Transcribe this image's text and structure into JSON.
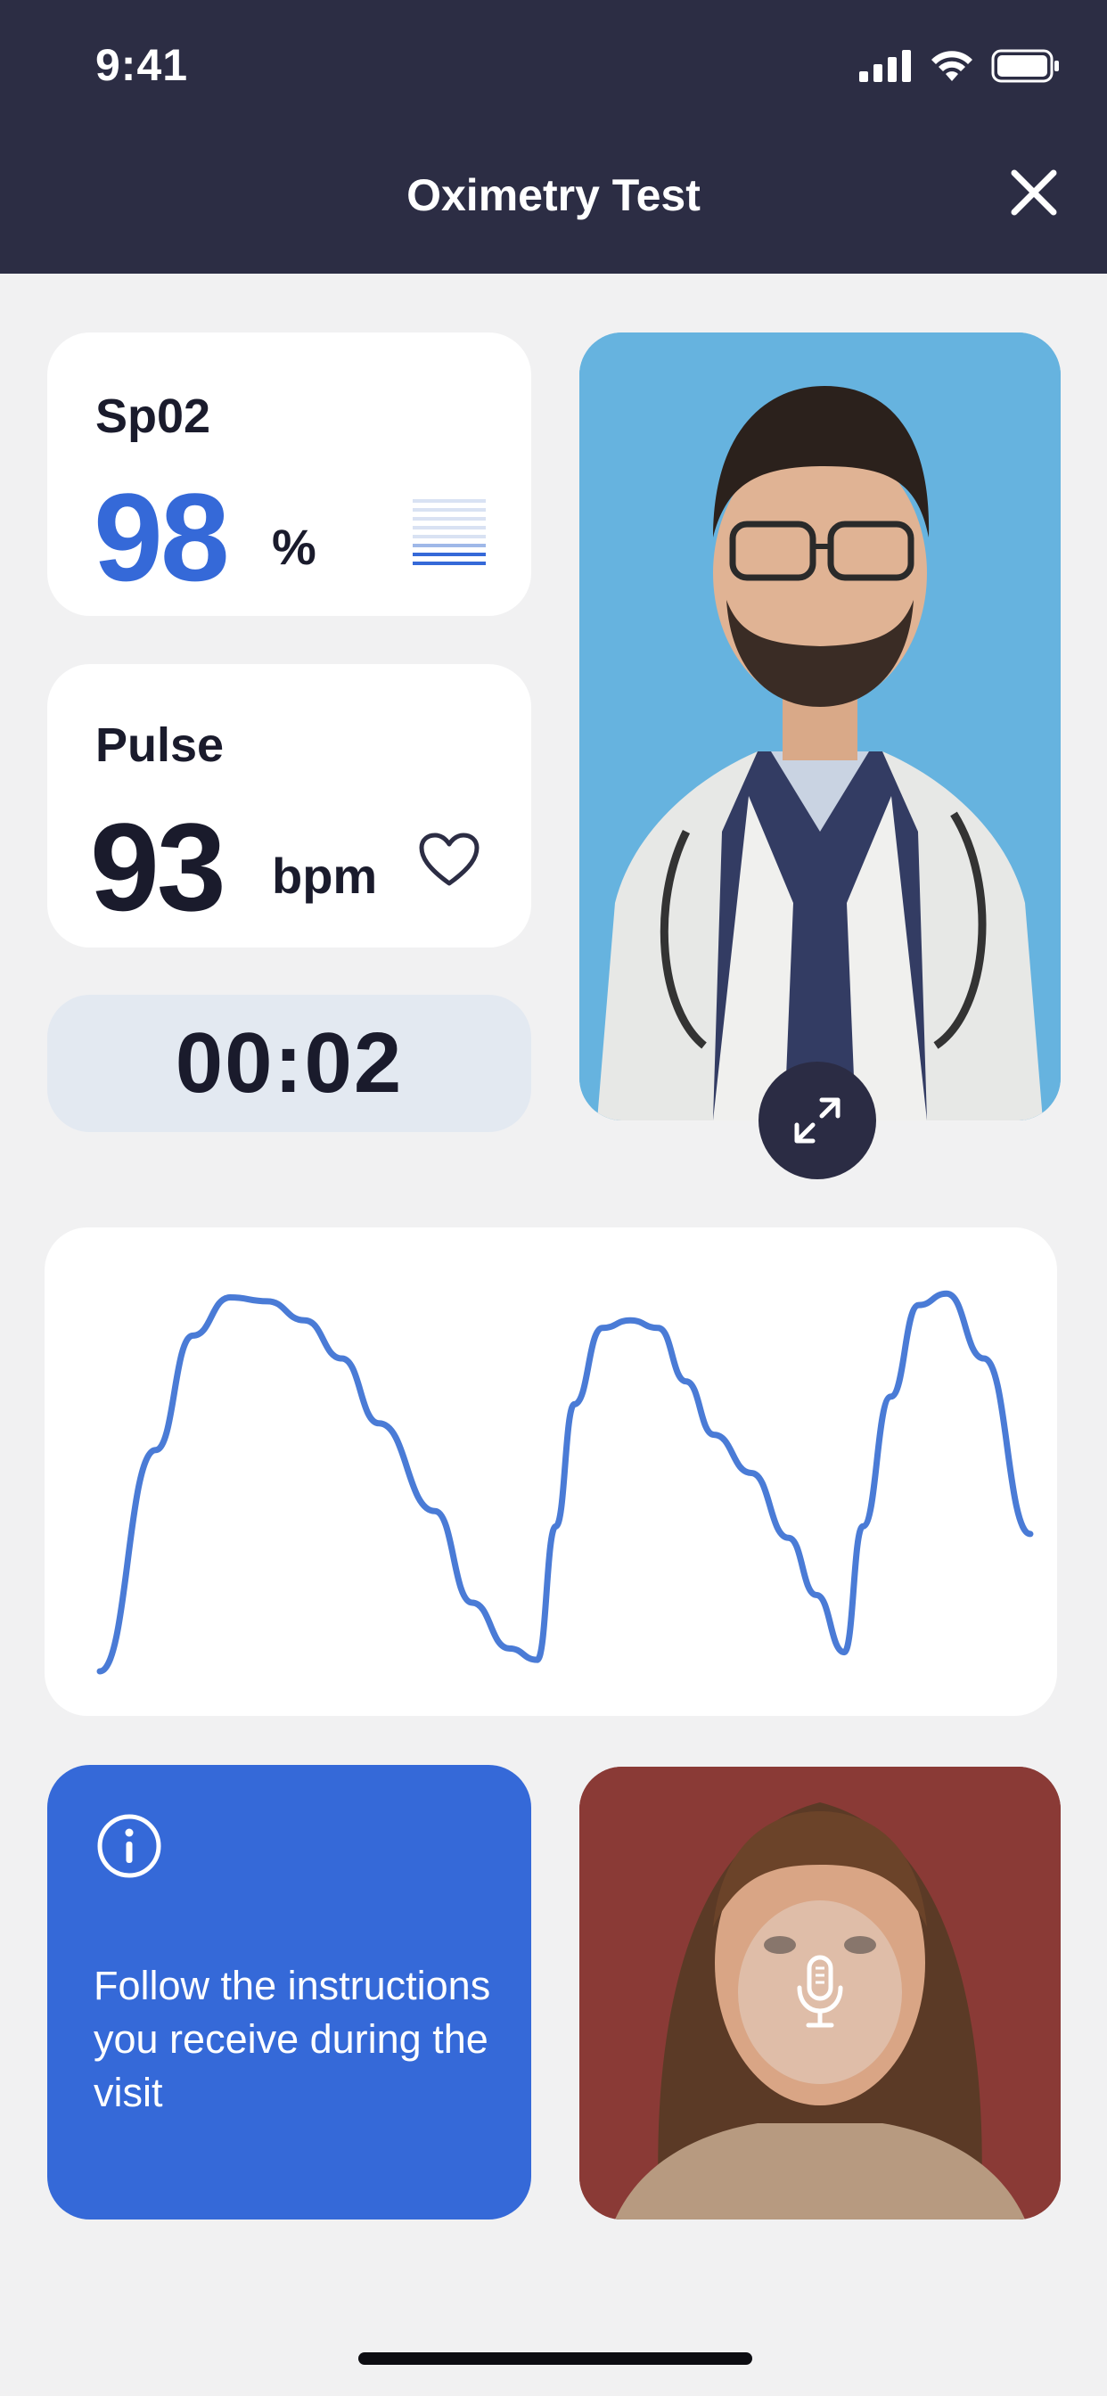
{
  "status_bar": {
    "time": "9:41"
  },
  "header": {
    "title": "Oximetry Test",
    "close_icon": "close-icon"
  },
  "spo2": {
    "label": "Sp02",
    "value": "98",
    "unit": "%",
    "signal_icon": "signal-bars-icon"
  },
  "pulse": {
    "label": "Pulse",
    "value": "93",
    "unit": "bpm",
    "icon": "heart-icon"
  },
  "timer": {
    "value": "00:02"
  },
  "doctor_video": {
    "expand_icon": "expand-icon"
  },
  "info": {
    "icon": "info-icon",
    "text": "Follow the instructions you receive during the visit"
  },
  "patient_video": {
    "mic_icon": "microphone-icon"
  },
  "colors": {
    "accent": "#3569d8",
    "header_bg": "#2c2d44",
    "waveform": "#4a7bd6"
  },
  "chart_data": {
    "type": "line",
    "x": [
      0,
      6,
      10,
      14,
      18,
      22,
      26,
      30,
      36,
      40,
      44,
      47,
      49,
      51,
      54,
      57,
      60,
      63,
      66,
      70,
      74,
      77,
      80,
      82,
      85,
      88,
      91,
      95,
      100
    ],
    "values": [
      0,
      58,
      88,
      98,
      97,
      92,
      82,
      65,
      42,
      18,
      6,
      3,
      38,
      70,
      90,
      92,
      90,
      76,
      62,
      52,
      35,
      20,
      5,
      38,
      72,
      96,
      99,
      82,
      36
    ],
    "title": "",
    "xlabel": "",
    "ylabel": "",
    "grid": false,
    "ylim": [
      0,
      100
    ]
  }
}
